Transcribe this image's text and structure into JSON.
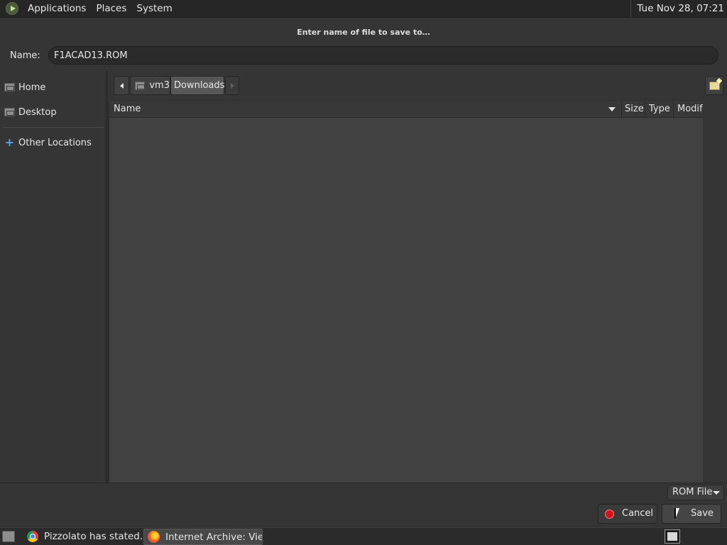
{
  "top_panel": {
    "menus": [
      "Applications",
      "Places",
      "System"
    ],
    "clock": "Tue Nov 28, 07:21"
  },
  "dialog": {
    "title": "Enter name of file to save to…",
    "name_label": "Name:",
    "name_value": "F1ACAD13.ROM",
    "sidebar": {
      "home": "Home",
      "desktop": "Desktop",
      "other_locations": "Other Locations"
    },
    "path": {
      "segments": [
        "vm3",
        "Downloads"
      ],
      "current": "Downloads"
    },
    "columns": {
      "name": "Name",
      "size": "Size",
      "type": "Type",
      "modified": "Modif"
    },
    "filter": "ROM File",
    "cancel_label": "Cancel",
    "save_label": "Save"
  },
  "taskbar": {
    "tasks": [
      {
        "label": "Pizzolato has stated…",
        "app": "chrome"
      },
      {
        "label": "Internet Archive: Vie…",
        "app": "firefox",
        "active": true
      }
    ]
  },
  "colors": {
    "background": "#2d2d2d",
    "panel": "#353535",
    "file_area": "#414141",
    "cancel_icon": "#d0141a",
    "location_accent": "#5aa0e0"
  }
}
